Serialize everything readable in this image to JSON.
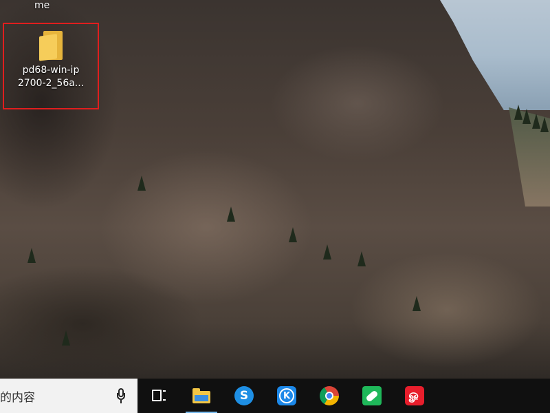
{
  "desktop": {
    "top_label": "me",
    "icons": [
      {
        "name": "pd68-win-ip\n2700-2_56a...",
        "line1": "pd68-win-ip",
        "line2": "2700-2_56a..."
      }
    ]
  },
  "taskbar": {
    "search_text": "的内容",
    "apps": [
      {
        "name": "File Explorer",
        "icon": "folder-icon"
      },
      {
        "name": "Sogou",
        "icon": "sogou-icon"
      },
      {
        "name": "KuGou",
        "icon": "kugou-icon",
        "glyph": "K"
      },
      {
        "name": "Google Chrome",
        "icon": "chrome-icon"
      },
      {
        "name": "Green app",
        "icon": "green-app-icon"
      },
      {
        "name": "NetEase Cloud Music",
        "icon": "netease-music-icon",
        "glyph": "ௐ"
      }
    ]
  },
  "colors": {
    "taskbar": "#101010",
    "selection_border": "#e01e1e",
    "active_indicator": "#76b9ed"
  }
}
